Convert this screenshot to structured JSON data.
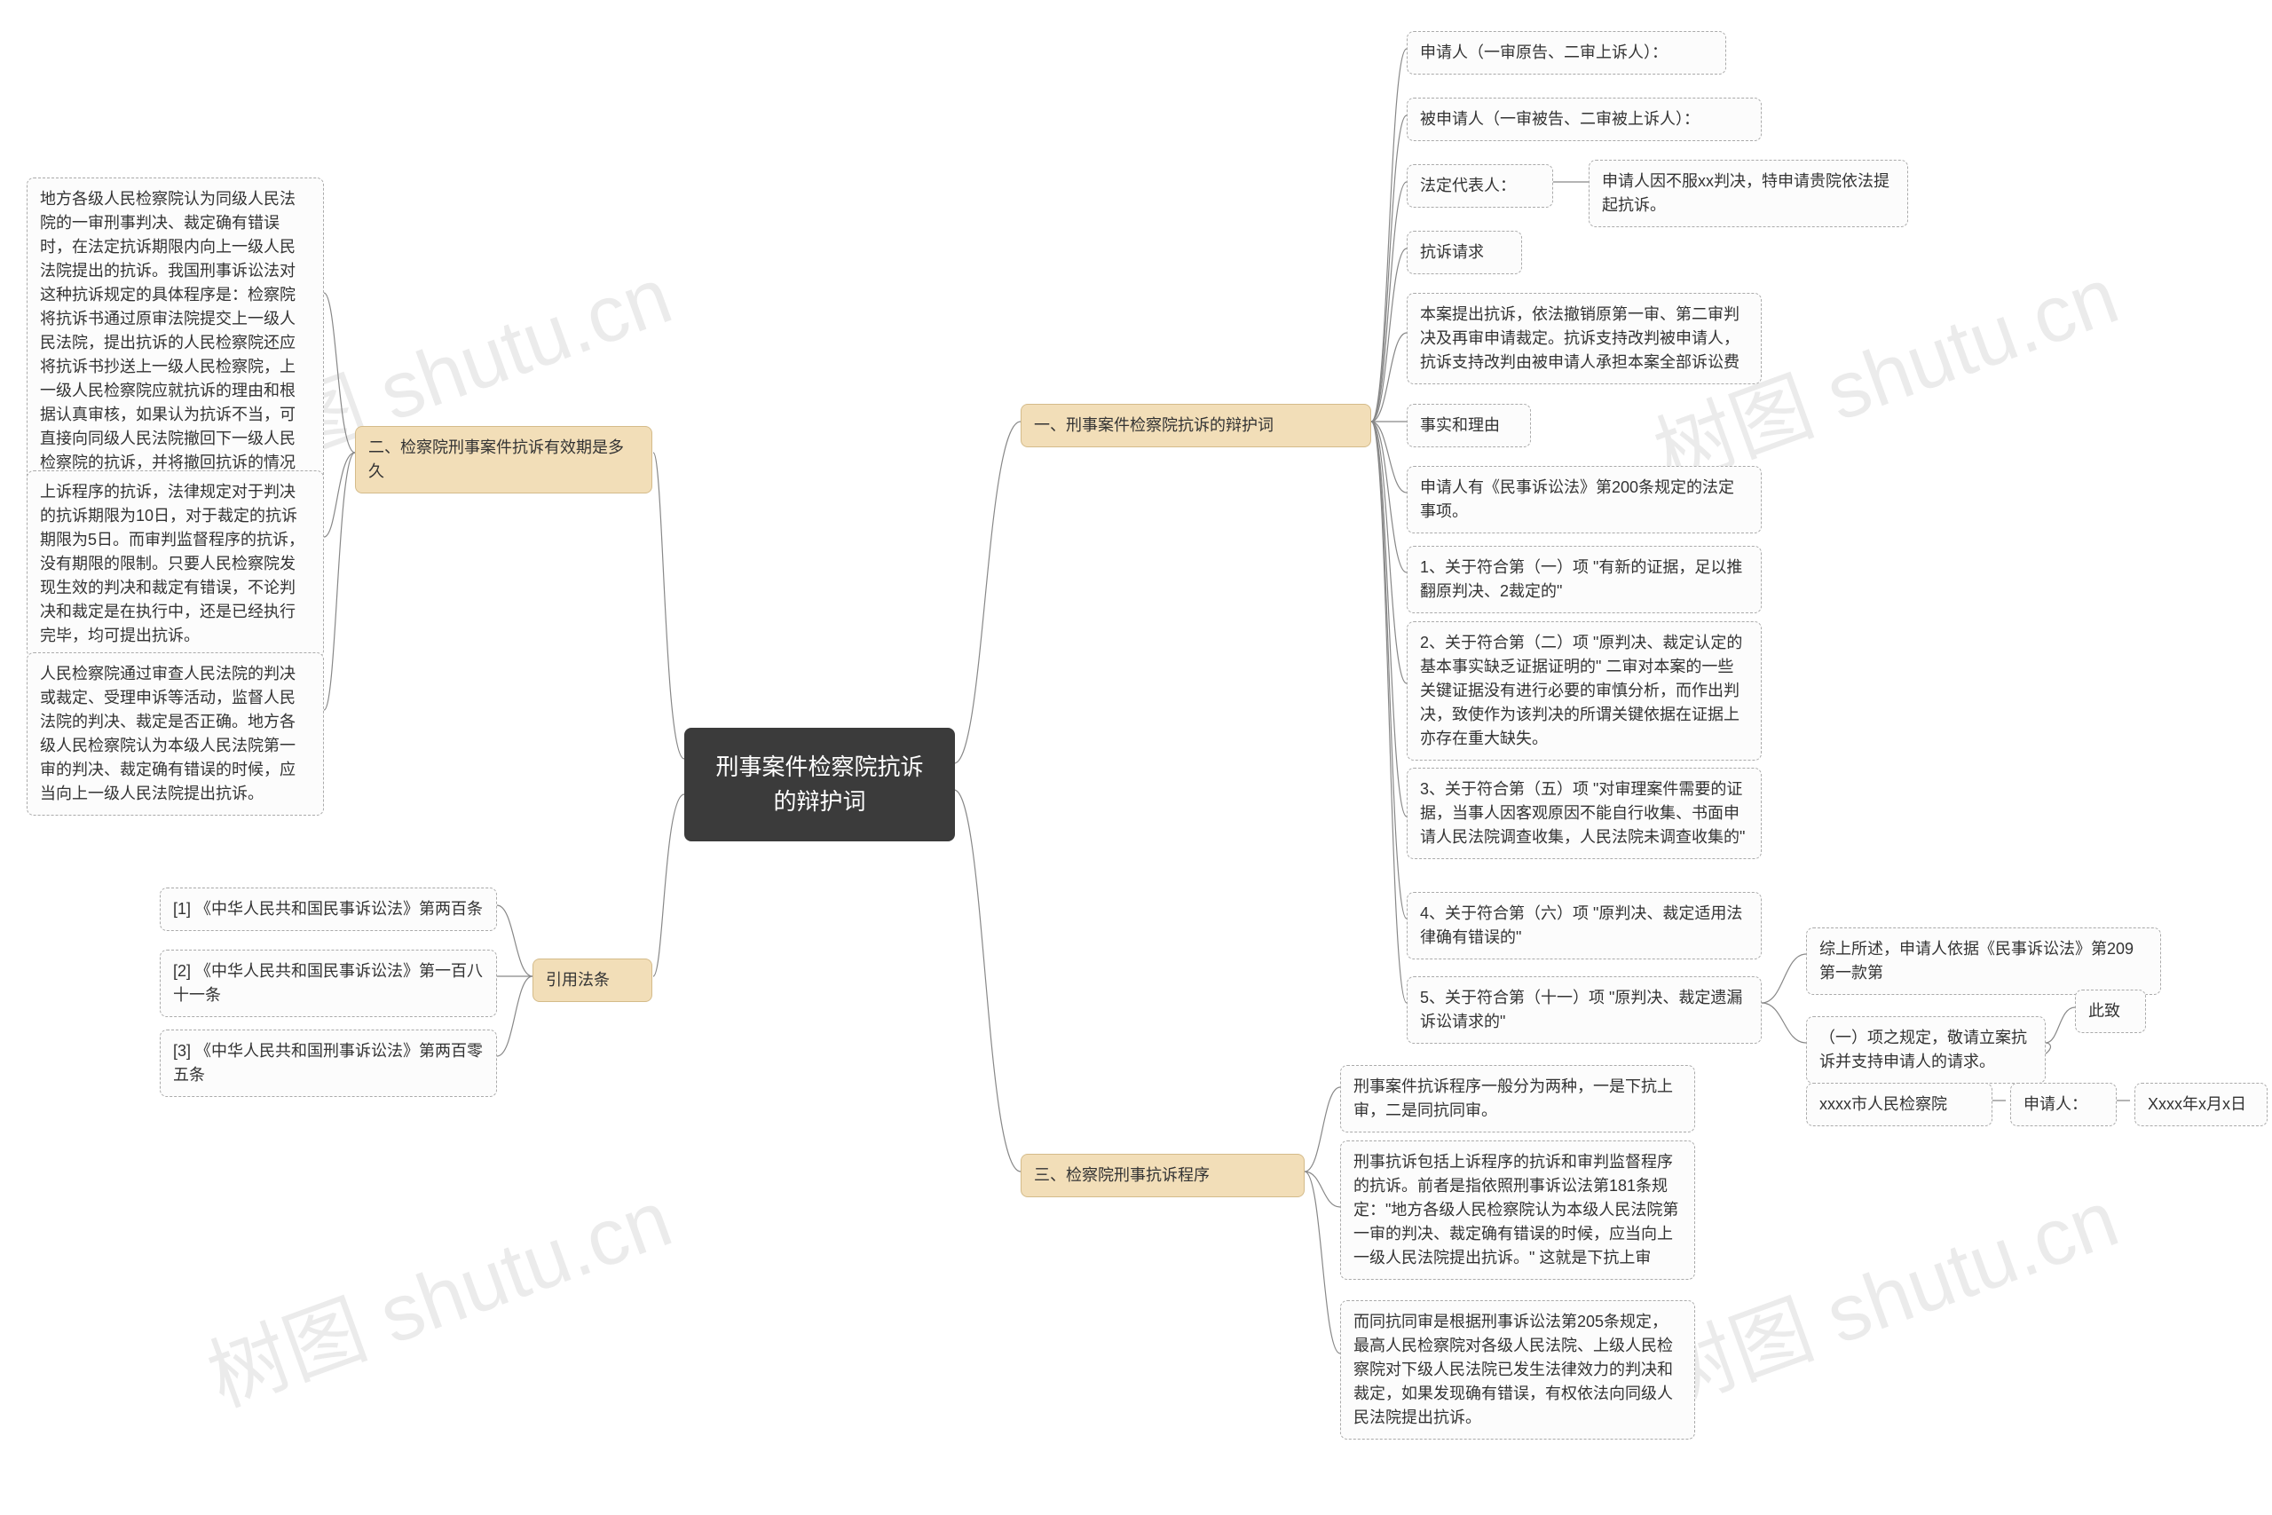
{
  "root": "刑事案件检察院抗诉的辩护词",
  "branches": {
    "b1": {
      "label": "一、刑事案件检察院抗诉的辩护词",
      "children": [
        "申请人（一审原告、二审上诉人）：",
        "被申请人（一审被告、二审被上诉人）：",
        "法定代表人：",
        "抗诉请求",
        "本案提出抗诉，依法撤销原第一审、第二审判决及再审申请裁定。抗诉支持改判被申请人，抗诉支持改判由被申请人承担本案全部诉讼费",
        "事实和理由",
        "申请人有《民事诉讼法》第200条规定的法定事项。",
        "1、关于符合第（一）项 \"有新的证据，足以推翻原判决、2裁定的\"",
        "2、关于符合第（二）项 \"原判决、裁定认定的基本事实缺乏证据证明的\" 二审对本案的一些关键证据没有进行必要的审慎分析，而作出判决，致使作为该判决的所谓关键依据在证据上亦存在重大缺失。",
        "3、关于符合第（五）项 \"对审理案件需要的证据，当事人因客观原因不能自行收集、书面申请人民法院调查收集，人民法院未调查收集的\"",
        "4、关于符合第（六）项 \"原判决、裁定适用法律确有错误的\"",
        "5、关于符合第（十一）项 \"原判决、裁定遗漏诉讼请求的\""
      ],
      "rep_sub": "申请人因不服xx判决，特申请贵院依法提起抗诉。",
      "tail": {
        "t1": "综上所述，申请人依据《民事诉讼法》第209第一款第",
        "t2": "（一）项之规定，敬请立案抗诉并支持申请人的请求。",
        "t3": "此致",
        "t4": "xxxx市人民检察院",
        "t5": "申请人：",
        "t6": "Xxxx年x月x日"
      }
    },
    "b2": {
      "label": "二、检察院刑事案件抗诉有效期是多久",
      "children": [
        "地方各级人民检察院认为同级人民法院的一审刑事判决、裁定确有错误时，在法定抗诉期限内向上一级人民法院提出的抗诉。我国刑事诉讼法对这种抗诉规定的具体程序是：检察院将抗诉书通过原审法院提交上一级人民法院，提出抗诉的人民检察院还应将抗诉书抄送上一级人民检察院，上一级人民检察院应就抗诉的理由和根据认真审核，如果认为抗诉不当，可直接向同级人民法院撤回下一级人民检察院的抗诉，并将撤回抗诉的情况通知下一级人民检察院。",
        "上诉程序的抗诉，法律规定对于判决的抗诉期限为10日，对于裁定的抗诉期限为5日。而审判监督程序的抗诉，没有期限的限制。只要人民检察院发现生效的判决和裁定有错误，不论判决和裁定是在执行中，还是已经执行完毕，均可提出抗诉。",
        "人民检察院通过审查人民法院的判决或裁定、受理申诉等活动，监督人民法院的判决、裁定是否正确。地方各级人民检察院认为本级人民法院第一审的判决、裁定确有错误的时候，应当向上一级人民法院提出抗诉。"
      ]
    },
    "b3": {
      "label": "三、检察院刑事抗诉程序",
      "children": [
        "刑事案件抗诉程序一般分为两种，一是下抗上审，二是同抗同审。",
        "刑事抗诉包括上诉程序的抗诉和审判监督程序的抗诉。前者是指依照刑事诉讼法第181条规定：\"地方各级人民检察院认为本级人民法院第一审的判决、裁定确有错误的时候，应当向上一级人民法院提出抗诉。\" 这就是下抗上审",
        "而同抗同审是根据刑事诉讼法第205条规定，最高人民检察院对各级人民法院、上级人民检察院对下级人民法院已发生法律效力的判决和裁定，如果发现确有错误，有权依法向同级人民法院提出抗诉。"
      ]
    },
    "b4": {
      "label": "引用法条",
      "children": [
        "[1] 《中华人民共和国民事诉讼法》第两百条",
        "[2] 《中华人民共和国民事诉讼法》第一百八十一条",
        "[3] 《中华人民共和国刑事诉讼法》第两百零五条"
      ]
    }
  },
  "watermark": "树图 shutu.cn"
}
